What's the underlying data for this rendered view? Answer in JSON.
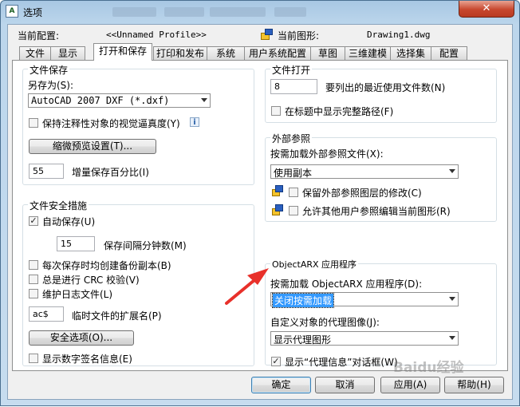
{
  "window": {
    "title": "选项",
    "close_glyph": "✕"
  },
  "header": {
    "current_profile_label": "当前配置:",
    "current_profile_value": "<<Unnamed Profile>>",
    "current_drawing_label": "当前图形:",
    "current_drawing_value": "Drawing1.dwg"
  },
  "tabs": [
    {
      "label": "文件"
    },
    {
      "label": "显示"
    },
    {
      "label": "打开和保存",
      "active": true
    },
    {
      "label": "打印和发布"
    },
    {
      "label": "系统"
    },
    {
      "label": "用户系统配置"
    },
    {
      "label": "草图"
    },
    {
      "label": "三维建模"
    },
    {
      "label": "选择集"
    },
    {
      "label": "配置"
    }
  ],
  "file_save": {
    "title": "文件保存",
    "save_as_label": "另存为(S):",
    "save_as_value": "AutoCAD 2007 DXF (*.dxf)",
    "annotative_label": "保持注释性对象的视觉逼真度(Y)",
    "annotative_checked": false,
    "thumbnail_button": "缩微预览设置(T)...",
    "incremental_value": "55",
    "incremental_label": "增量保存百分比(I)"
  },
  "file_safety": {
    "title": "文件安全措施",
    "autosave_label": "自动保存(U)",
    "autosave_checked": true,
    "minutes_value": "15",
    "minutes_label": "保存间隔分钟数(M)",
    "backup_label": "每次保存时均创建备份副本(B)",
    "backup_checked": false,
    "crc_label": "总是进行 CRC 校验(V)",
    "crc_checked": false,
    "log_label": "维护日志文件(L)",
    "log_checked": false,
    "temp_ext_value": "ac$",
    "temp_ext_label": "临时文件的扩展名(P)",
    "security_button": "安全选项(O)...",
    "digital_sig_label": "显示数字签名信息(E)",
    "digital_sig_checked": false
  },
  "file_open": {
    "title": "文件打开",
    "recent_value": "8",
    "recent_label": "要列出的最近使用文件数(N)",
    "full_path_label": "在标题中显示完整路径(F)",
    "full_path_checked": false
  },
  "xref": {
    "title": "外部参照",
    "demand_load_label": "按需加载外部参照文件(X):",
    "demand_load_value": "使用副本",
    "retain_label": "保留外部参照图层的修改(C)",
    "retain_checked": false,
    "allow_edit_label": "允许其他用户参照编辑当前图形(R)",
    "allow_edit_checked": false
  },
  "objectarx": {
    "title": "ObjectARX 应用程序",
    "demand_load_label": "按需加载 ObjectARX 应用程序(D):",
    "demand_load_value": "关闭按需加载",
    "proxy_images_label": "自定义对象的代理图像(J):",
    "proxy_images_value": "显示代理图形",
    "proxy_info_label": "显示“代理信息”对话框(W)",
    "proxy_info_checked": true
  },
  "buttons": {
    "ok": "确定",
    "cancel": "取消",
    "apply": "应用(A)",
    "help": "帮助(H)"
  },
  "annotation": {
    "arrow_color": "#e8302a"
  },
  "watermark": "Baidu经验"
}
